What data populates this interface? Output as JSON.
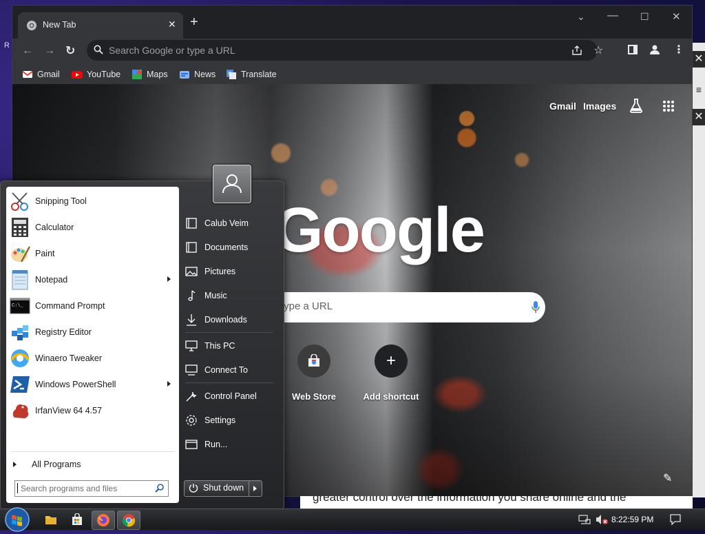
{
  "desktop": {
    "corner_text": "R"
  },
  "browser": {
    "tab": {
      "title": "New Tab"
    },
    "omnibox": {
      "placeholder": "Search Google or type a URL"
    },
    "bookmarks": [
      {
        "label": "Gmail",
        "icon": "gmail-icon",
        "color": "#ea4335"
      },
      {
        "label": "YouTube",
        "icon": "youtube-icon",
        "color": "#ff0000"
      },
      {
        "label": "Maps",
        "icon": "maps-icon",
        "color": "#34a853"
      },
      {
        "label": "News",
        "icon": "news-icon",
        "color": "#4285f4"
      },
      {
        "label": "Translate",
        "icon": "translate-icon",
        "color": "#4285f4"
      }
    ],
    "ntp": {
      "links": {
        "gmail": "Gmail",
        "images": "Images"
      },
      "logo": "Google",
      "search_placeholder": "type a URL",
      "shortcuts": [
        {
          "label": "Web Store",
          "icon": "web-store-icon"
        },
        {
          "label": "Add shortcut",
          "icon": "plus-icon"
        }
      ]
    },
    "page_snippet": "greater control over the information you share online and the"
  },
  "start_menu": {
    "programs": [
      {
        "label": "Snipping Tool",
        "icon": "snipping-tool-icon",
        "submenu": false
      },
      {
        "label": "Calculator",
        "icon": "calculator-icon",
        "submenu": false
      },
      {
        "label": "Paint",
        "icon": "paint-icon",
        "submenu": false
      },
      {
        "label": "Notepad",
        "icon": "notepad-icon",
        "submenu": true
      },
      {
        "label": "Command Prompt",
        "icon": "command-prompt-icon",
        "submenu": false
      },
      {
        "label": "Registry Editor",
        "icon": "registry-editor-icon",
        "submenu": false
      },
      {
        "label": "Winaero Tweaker",
        "icon": "winaero-tweaker-icon",
        "submenu": false
      },
      {
        "label": "Windows PowerShell",
        "icon": "powershell-icon",
        "submenu": true
      },
      {
        "label": "IrfanView 64 4.57",
        "icon": "irfanview-icon",
        "submenu": false
      }
    ],
    "all_programs": "All Programs",
    "search_placeholder": "Search programs and files",
    "places": [
      {
        "label": "Calub Veim",
        "icon": "user-folder-icon"
      },
      {
        "label": "Documents",
        "icon": "documents-icon"
      },
      {
        "label": "Pictures",
        "icon": "pictures-icon"
      },
      {
        "label": "Music",
        "icon": "music-icon"
      },
      {
        "label": "Downloads",
        "icon": "downloads-icon"
      },
      {
        "label": "This PC",
        "icon": "this-pc-icon"
      },
      {
        "label": "Connect To",
        "icon": "connect-to-icon"
      },
      {
        "label": "Control Panel",
        "icon": "control-panel-icon"
      },
      {
        "label": "Settings",
        "icon": "settings-icon"
      },
      {
        "label": "Run...",
        "icon": "run-icon"
      }
    ],
    "shutdown_label": "Shut down"
  },
  "taskbar": {
    "clock": "8:22:59 PM",
    "pinned": [
      "file-explorer-icon",
      "store-icon",
      "firefox-icon",
      "chrome-icon"
    ]
  }
}
